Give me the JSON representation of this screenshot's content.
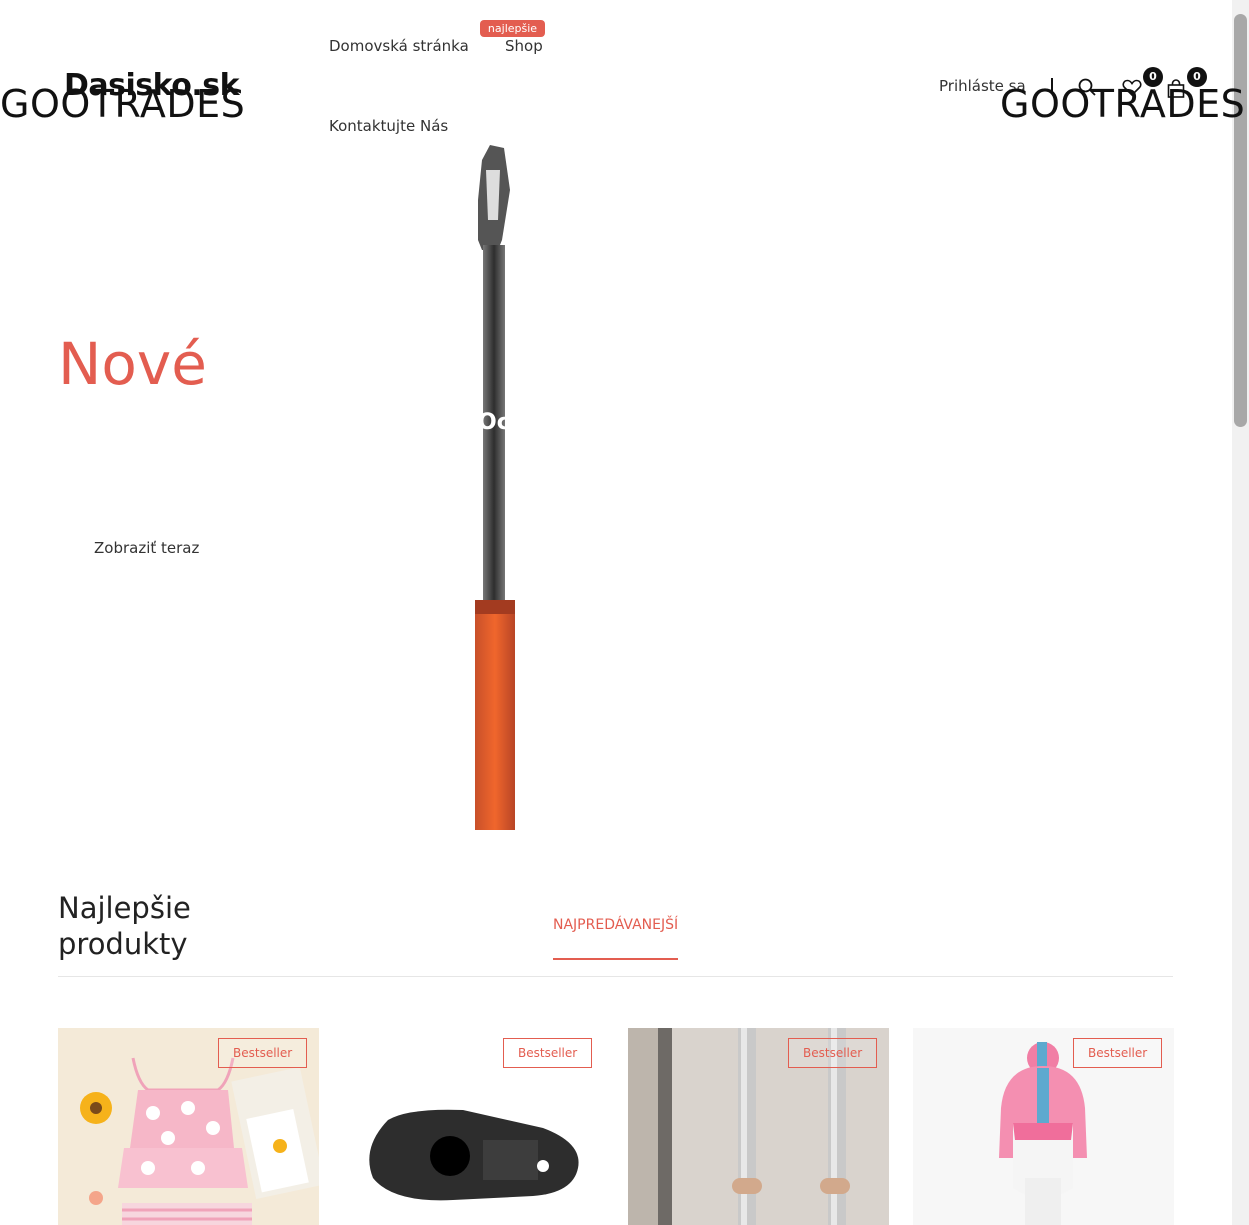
{
  "header": {
    "logo": "Dasisko.sk",
    "overlay_logo_left": "GOOTRADES",
    "overlay_logo_right": "GOOTRADES",
    "nav": {
      "home": "Domovská stránka",
      "shop": "Shop",
      "shop_badge": "najlepšie",
      "contact": "Kontaktujte Nás"
    },
    "login": "Prihláste sa",
    "wishlist_count": "0",
    "cart_count": "0",
    "icons": [
      "search-icon",
      "heart-icon",
      "bag-icon"
    ]
  },
  "hero": {
    "title": "Nové",
    "subtitle": "Oc",
    "cta": "Zobraziť teraz"
  },
  "products_section": {
    "title": "Najlepšie produkty",
    "tab": "NAJPREDÁVANEJŠÍ",
    "cards": [
      {
        "badge": "Bestseller"
      },
      {
        "badge": "Bestseller"
      },
      {
        "badge": "Bestseller"
      },
      {
        "badge": "Bestseller"
      }
    ]
  },
  "colors": {
    "accent": "#e35d50",
    "text": "#222222",
    "dark": "#111111"
  }
}
